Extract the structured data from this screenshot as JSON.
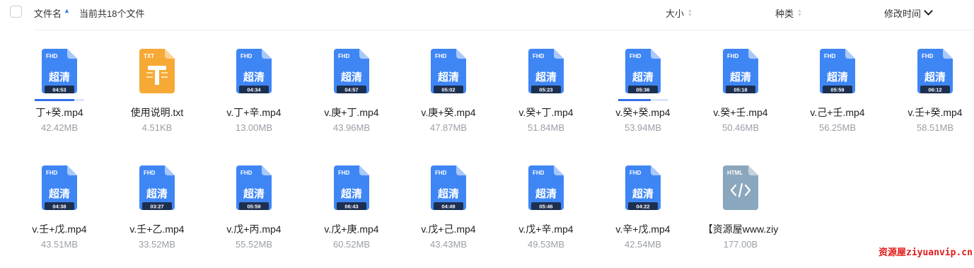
{
  "header": {
    "col_name": "文件名",
    "file_count": "当前共18个文件",
    "col_size": "大小",
    "col_type": "种类",
    "col_modified": "修改时间"
  },
  "files": [
    {
      "name": "丁+癸.mp4",
      "size": "42.42MB",
      "kind": "video",
      "badge": "FHD",
      "quality": "超清",
      "duration": "04:53",
      "progress": 0.8
    },
    {
      "name": "使用说明.txt",
      "size": "4.51KB",
      "kind": "txt",
      "badge": "TXT"
    },
    {
      "name": "v.丁+辛.mp4",
      "size": "13.00MB",
      "kind": "video",
      "badge": "FHD",
      "quality": "超清",
      "duration": "04:34"
    },
    {
      "name": "v.庚+丁.mp4",
      "size": "43.96MB",
      "kind": "video",
      "badge": "FHD",
      "quality": "超清",
      "duration": "04:57"
    },
    {
      "name": "v.庚+癸.mp4",
      "size": "47.87MB",
      "kind": "video",
      "badge": "FHD",
      "quality": "超清",
      "duration": "05:02"
    },
    {
      "name": "v.癸+丁.mp4",
      "size": "51.84MB",
      "kind": "video",
      "badge": "FHD",
      "quality": "超清",
      "duration": "05:23"
    },
    {
      "name": "v.癸+癸.mp4",
      "size": "53.94MB",
      "kind": "video",
      "badge": "FHD",
      "quality": "超清",
      "duration": "05:36",
      "progress": 0.65
    },
    {
      "name": "v.癸+壬.mp4",
      "size": "50.46MB",
      "kind": "video",
      "badge": "FHD",
      "quality": "超清",
      "duration": "05:18"
    },
    {
      "name": "v.己+壬.mp4",
      "size": "56.25MB",
      "kind": "video",
      "badge": "FHD",
      "quality": "超清",
      "duration": "05:59"
    },
    {
      "name": "v.壬+癸.mp4",
      "size": "58.51MB",
      "kind": "video",
      "badge": "FHD",
      "quality": "超清",
      "duration": "06:12"
    },
    {
      "name": "v.壬+戊.mp4",
      "size": "43.51MB",
      "kind": "video",
      "badge": "FHD",
      "quality": "超清",
      "duration": "04:38"
    },
    {
      "name": "v.壬+乙.mp4",
      "size": "33.52MB",
      "kind": "video",
      "badge": "FHD",
      "quality": "超清",
      "duration": "03:27"
    },
    {
      "name": "v.戊+丙.mp4",
      "size": "55.52MB",
      "kind": "video",
      "badge": "FHD",
      "quality": "超清",
      "duration": "05:59"
    },
    {
      "name": "v.戊+庚.mp4",
      "size": "60.52MB",
      "kind": "video",
      "badge": "FHD",
      "quality": "超清",
      "duration": "06:43"
    },
    {
      "name": "v.戊+己.mp4",
      "size": "43.43MB",
      "kind": "video",
      "badge": "FHD",
      "quality": "超清",
      "duration": "04:49"
    },
    {
      "name": "v.戊+辛.mp4",
      "size": "49.53MB",
      "kind": "video",
      "badge": "FHD",
      "quality": "超清",
      "duration": "05:46"
    },
    {
      "name": "v.辛+戊.mp4",
      "size": "42.54MB",
      "kind": "video",
      "badge": "FHD",
      "quality": "超清",
      "duration": "04:22"
    },
    {
      "name": "【资源屋www.ziy",
      "size": "177.00B",
      "kind": "html",
      "badge": "HTML"
    }
  ],
  "watermark": "资源屋ziyuanvip.cn",
  "colors": {
    "video_icon": "#3f86f5",
    "video_fold": "#a9c8fb",
    "txt_icon": "#f7a936",
    "txt_fold": "#fbd394",
    "html_icon": "#8aa7bd",
    "html_fold": "#c4d3de",
    "duration_bg": "#1d2f4f",
    "progress": "#2f6fe8"
  }
}
